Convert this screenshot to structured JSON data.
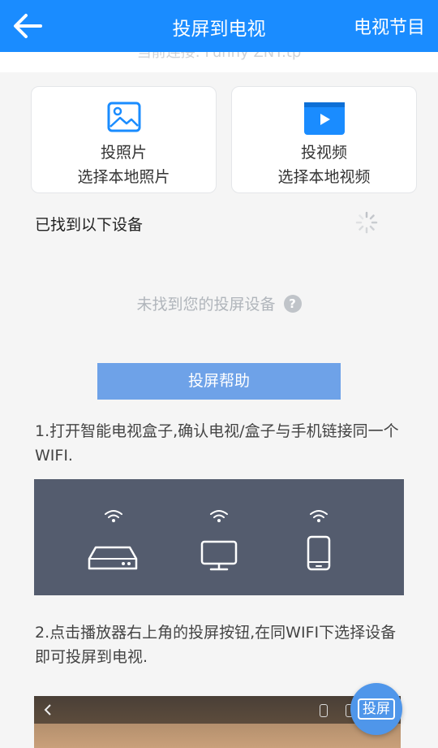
{
  "header": {
    "title": "投屏到电视",
    "right_action": "电视节目"
  },
  "connection": {
    "status_text": "当前连接: Funny ZNT.tp"
  },
  "cards": [
    {
      "title": "投照片",
      "subtitle": "选择本地照片",
      "icon": "image-icon"
    },
    {
      "title": "投视频",
      "subtitle": "选择本地视频",
      "icon": "video-play-icon"
    }
  ],
  "devices": {
    "label": "已找到以下设备",
    "empty_text": "未找到您的投屏设备",
    "help_icon": "?"
  },
  "help_button": "投屏帮助",
  "steps": [
    "1.打开智能电视盒子,确认电视/盒子与手机链接同一个WIFI.",
    "2.点击播放器右上角的投屏按钮,在同WIFI下选择设备即可投屏到电视."
  ],
  "fab_label": "投屏",
  "colors": {
    "primary": "#1a8cff",
    "button": "#6ea2e8",
    "illustration_bg": "#545c6e"
  }
}
